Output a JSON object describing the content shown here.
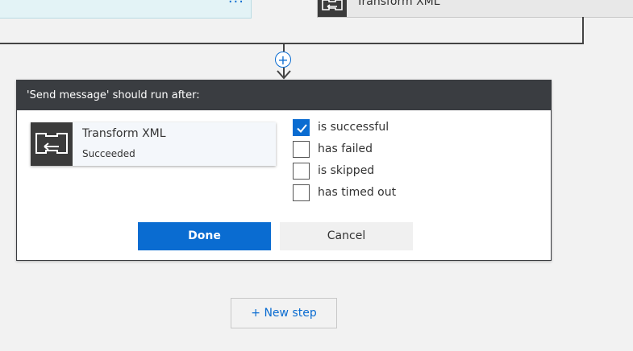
{
  "scope_card": {
    "more_label": "···"
  },
  "top_action": {
    "title": "Transform XML",
    "icon": "transform-xml-icon"
  },
  "connector": {
    "insert_label": "+"
  },
  "dialog": {
    "title": "'Send message' should run after:",
    "action": {
      "title": "Transform XML",
      "status": "Succeeded",
      "icon": "transform-xml-icon"
    },
    "conditions": [
      {
        "label": "is successful",
        "checked": true
      },
      {
        "label": "has failed",
        "checked": false
      },
      {
        "label": "is skipped",
        "checked": false
      },
      {
        "label": "has timed out",
        "checked": false
      }
    ],
    "done_label": "Done",
    "cancel_label": "Cancel"
  },
  "new_step_label": "+ New step",
  "colors": {
    "accent": "#0a6cd1",
    "header_bg": "#3a3d41",
    "icon_bg": "#3b3b3b"
  }
}
